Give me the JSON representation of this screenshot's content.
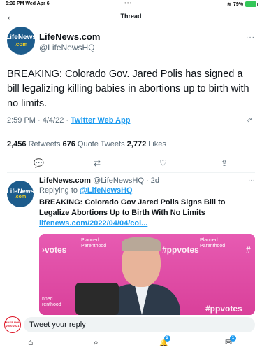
{
  "status_bar": {
    "time": "5:39 PM  Wed Apr 6",
    "dots": "•••",
    "battery": "79%"
  },
  "top_bar": {
    "back_icon": "←",
    "title": "Thread"
  },
  "main_tweet": {
    "avatar_line1": "LifeNews",
    "avatar_line2": ".com",
    "name": "LifeNews.com",
    "handle": "@LifeNewsHQ",
    "more_icon": "···",
    "text": "BREAKING: Colorado Gov. Jared Polis has signed a bill legalizing killing babies in abortions up to birth with no limits.",
    "time": "2:59 PM · 4/4/22 · ",
    "source": "Twitter Web App",
    "retweets_count": "2,456",
    "retweets_label": " Retweets ",
    "quotes_count": "676",
    "quotes_label": " Quote Tweets ",
    "likes_count": "2,772",
    "likes_label": " Likes"
  },
  "actions": {
    "reply_icon": "💬",
    "retweet_icon": "⇄",
    "like_icon": "♡",
    "share_icon": "⇪"
  },
  "reply_tweet": {
    "avatar_line1": "LifeNews",
    "avatar_line2": ".com",
    "name": "LifeNews.com",
    "handle_time": " @LifeNewsHQ · 2d",
    "more_icon": "···",
    "replying_prefix": "Replying to ",
    "replying_to": "@LifeNewsHQ",
    "text": "BREAKING: Colorado Gov Jared Polis Signs Bill to Legalize Abortions Up to Birth With No Limits ",
    "link": "lifenews.com/2022/04/04/col..."
  },
  "media": {
    "left_text": "›votes",
    "center_text": "#ppvotes",
    "right_text": "#",
    "bottom_right_text": "#ppvotes",
    "pp_logo": "Planned Parenthood",
    "bottom_left": "nned renthood"
  },
  "composer": {
    "avatar_text": "MAKE ROE 2050 2021",
    "placeholder": "Tweet your reply"
  },
  "tabbar": {
    "home_icon": "⌂",
    "search_icon": "⌕",
    "notif_icon": "🔔",
    "notif_badge": "2",
    "messages_icon": "✉",
    "messages_badge": "1"
  }
}
